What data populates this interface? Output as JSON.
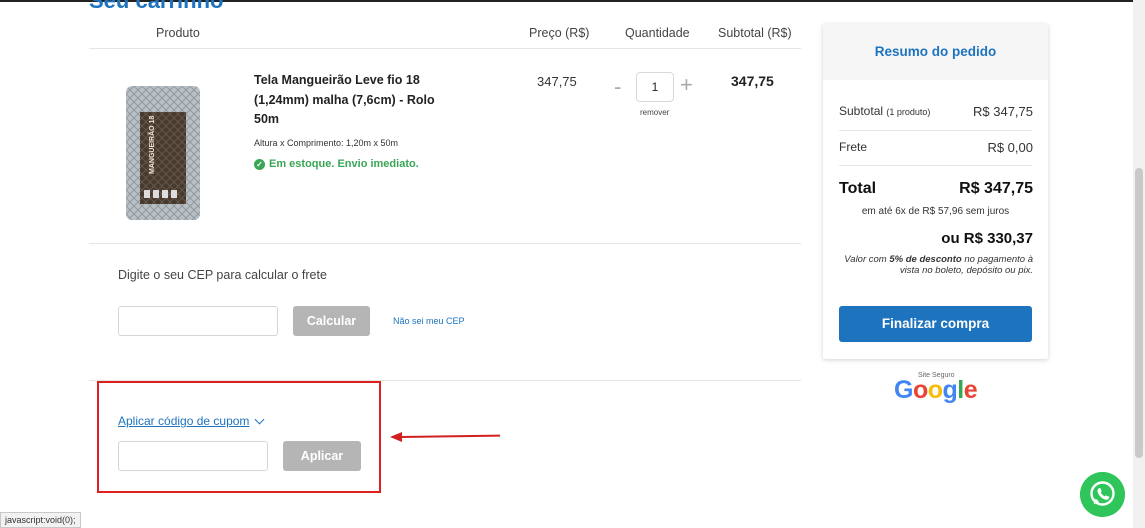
{
  "cart": {
    "title": "Seu carrinho",
    "headers": {
      "product": "Produto",
      "price": "Preço (R$)",
      "quantity": "Quantidade",
      "subtotal": "Subtotal (R$)"
    },
    "item": {
      "name": "Tela Mangueirão Leve fio 18 (1,24mm) malha (7,6cm) - Rolo 50m",
      "attributes": "Altura x Comprimento: 1,20m x 50m",
      "stock": "Em estoque. Envio imediato.",
      "price": "347,75",
      "quantity": "1",
      "minus": "-",
      "plus": "+",
      "remove": "remover",
      "subtotal": "347,75",
      "image_label": "MANGUEIRÃO 18"
    }
  },
  "shipping": {
    "label": "Digite o seu CEP para calcular o frete",
    "input_value": "",
    "calculate_label": "Calcular",
    "unknown_cep": "Não sei meu CEP"
  },
  "coupon": {
    "toggle_label": "Aplicar código de cupom",
    "input_value": "",
    "apply_label": "Aplicar"
  },
  "summary": {
    "title": "Resumo do pedido",
    "subtotal_label": "Subtotal",
    "subtotal_count": "(1 produto)",
    "subtotal_value": "R$ 347,75",
    "shipping_label": "Frete",
    "shipping_value": "R$ 0,00",
    "total_label": "Total",
    "total_value": "R$ 347,75",
    "installments": "em até 6x de R$ 57,96 sem juros",
    "discount_value": "ou R$ 330,37",
    "discount_note_prefix": "Valor com ",
    "discount_note_bold": "5% de desconto",
    "discount_note_suffix": " no pagamento à vista no boleto, depósito ou pix.",
    "finalize_label": "Finalizar compra"
  },
  "badge": {
    "small_text": "Site Seguro",
    "logo_letters": [
      "G",
      "o",
      "o",
      "g",
      "l",
      "e"
    ],
    "logo_colors": [
      "#4285f4",
      "#ea4335",
      "#fbbc05",
      "#4285f4",
      "#34a853",
      "#ea4335"
    ]
  },
  "status_bar": {
    "text": "javascript:void(0);"
  },
  "colors": {
    "primary": "#1e73be",
    "success": "#3aa655",
    "annotation": "#e01f1f",
    "whatsapp": "#2fc55a"
  },
  "icons": {
    "stock": "check-circle-icon",
    "coupon_toggle": "chevron-down-icon",
    "chat": "whatsapp-icon"
  }
}
